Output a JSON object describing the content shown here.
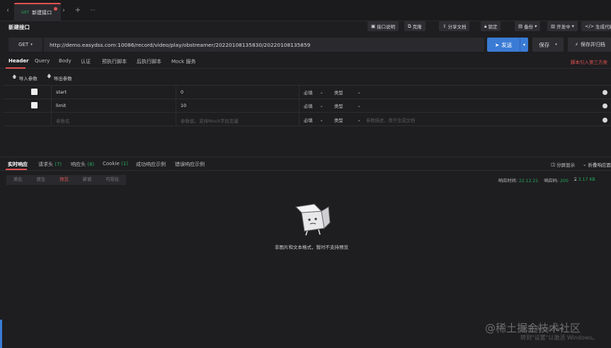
{
  "tabstrip": {
    "active_tab": {
      "method": "GET",
      "name": "新建接口"
    },
    "plus": "+",
    "more": "···"
  },
  "header": {
    "title": "新建接口",
    "buttons": {
      "api_doc": "接口说明",
      "copy": "克隆",
      "share": "分享文档",
      "lock": "锁定",
      "backup": "备份",
      "env": "开发中",
      "codegen": "生成代码"
    }
  },
  "request": {
    "method": "GET",
    "url": "http://demo.easydss.com:10086/record/video/play/obstreamer/20220108135830/20220108135859",
    "send_label": "发送",
    "save_label": "保存",
    "save_archive_label": "保存并归档"
  },
  "req_tabs": [
    "Header",
    "Query",
    "Body",
    "认证",
    "预执行脚本",
    "后执行脚本",
    "Mock 服务"
  ],
  "warning": "脚本引入第三方类",
  "import_label": "导入参数",
  "export_label": "导出参数",
  "params": [
    {
      "name": "start",
      "value": "0",
      "required": "必填",
      "type": "类型"
    },
    {
      "name": "limit",
      "value": "10",
      "required": "必填",
      "type": "类型"
    }
  ],
  "param_placeholder": {
    "name": "参数名",
    "value": "参数值，支持Mock字段变量",
    "required": "必填",
    "type": "类型",
    "desc": "参数描述，用于生成文档"
  },
  "resp_tabs": [
    {
      "label": "实时响应",
      "count": ""
    },
    {
      "label": "请求头",
      "count": "(7)"
    },
    {
      "label": "响应头",
      "count": "(8)"
    },
    {
      "label": "Cookie",
      "count": "(1)"
    },
    {
      "label": "成功响应示例",
      "count": ""
    },
    {
      "label": "错误响应示例",
      "count": ""
    }
  ],
  "resp_right": {
    "split": "分屏显示",
    "collapse": "折叠响应面"
  },
  "formats": [
    "美化",
    "原生",
    "预览",
    "新窗",
    "可视化"
  ],
  "resp_meta": {
    "time_label": "响应时间",
    "time_value": "22.12.21",
    "code_label": "响应码",
    "code_value": "200",
    "size_value": "3.17 KB"
  },
  "empty_text": "非图片和文本格式，暂时不支持预览",
  "watermark": "@稀土掘金技术社区",
  "activate_line1": "激活 Windows",
  "activate_line2": "转到\"设置\"以激活 Windows。",
  "colors": {
    "accent_red": "#e05252",
    "primary_blue": "#3a7bd5",
    "success_green": "#27a85d",
    "background": "#1e1e20"
  }
}
